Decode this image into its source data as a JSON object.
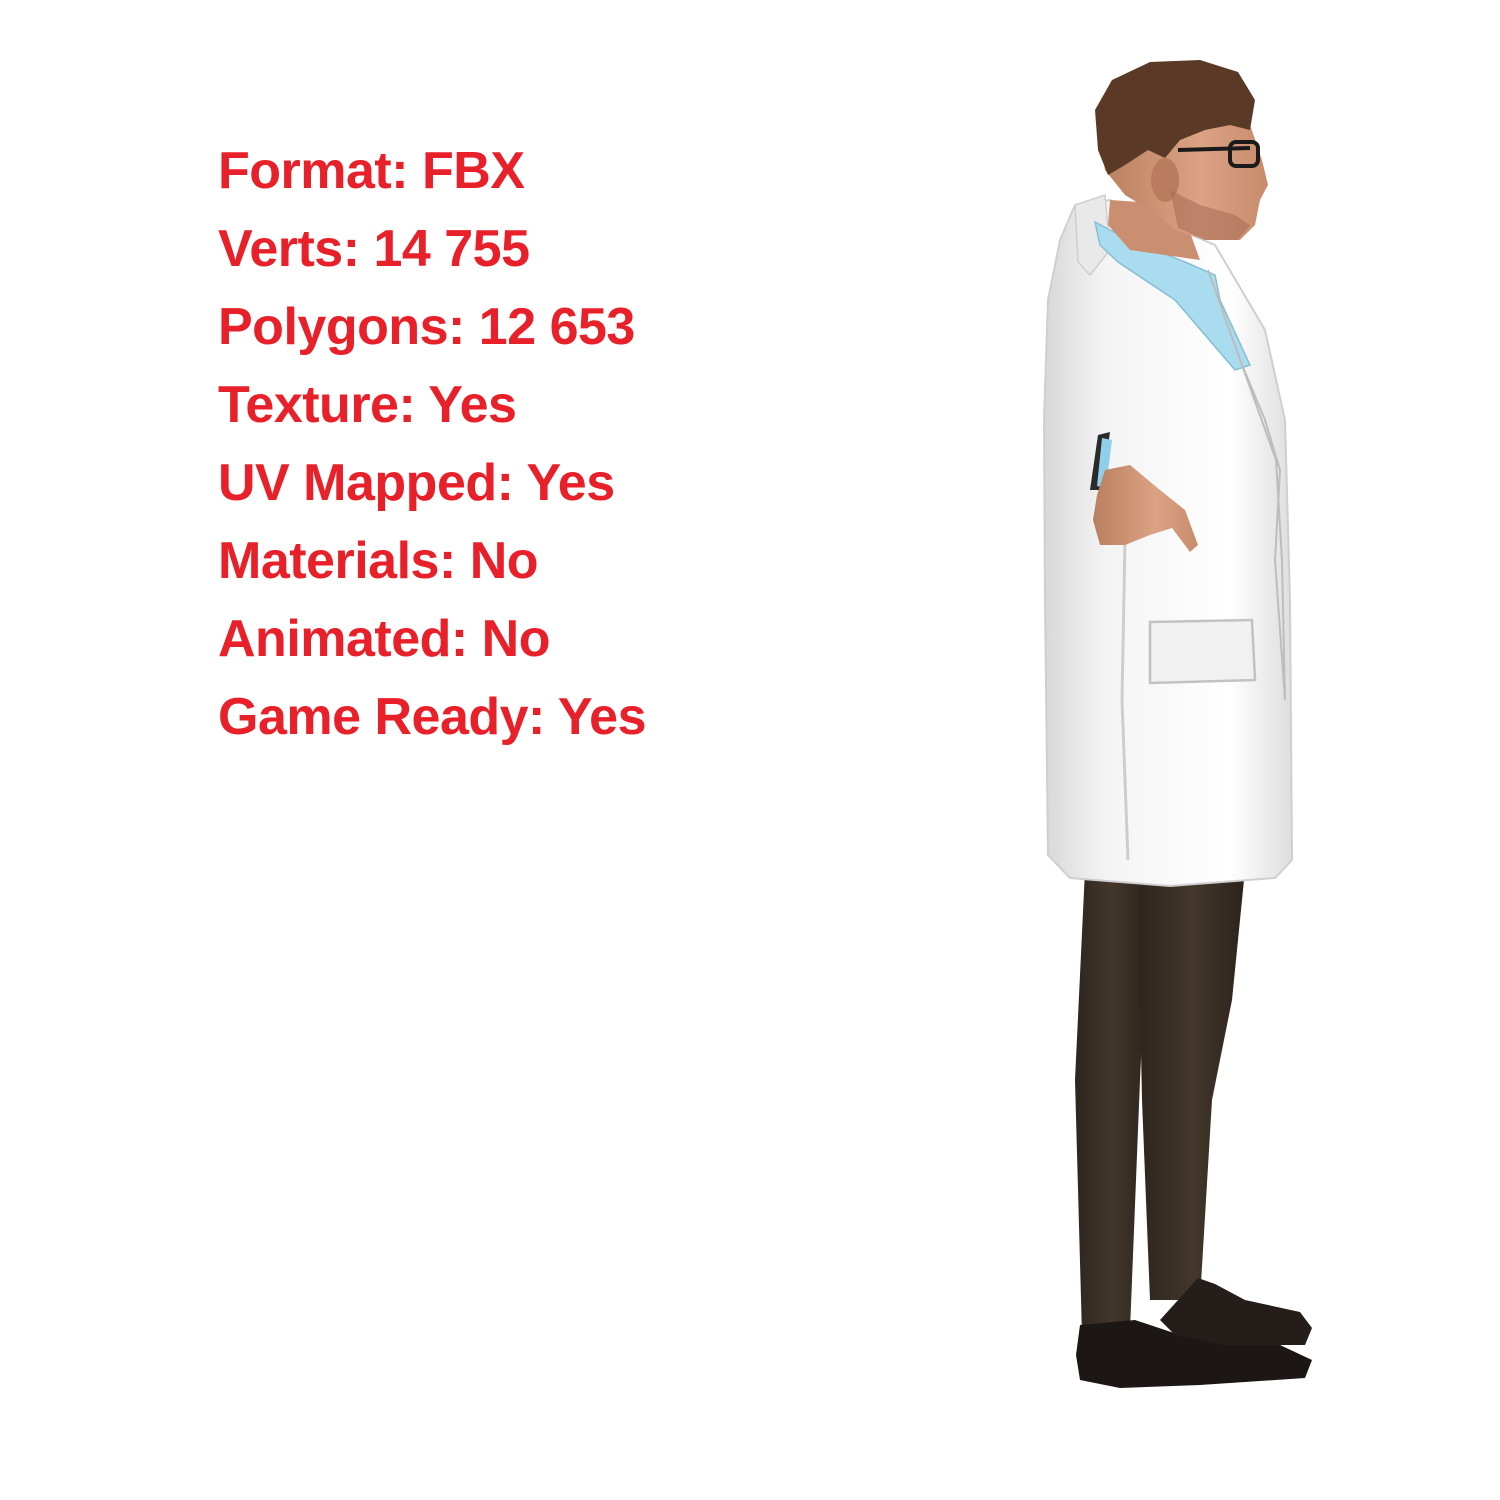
{
  "text_color": "#e8202a",
  "specs": [
    {
      "label": "Format: FBX"
    },
    {
      "label": "Verts: 14 755"
    },
    {
      "label": "Polygons: 12 653"
    },
    {
      "label": "Texture: Yes"
    },
    {
      "label": "UV Mapped: Yes"
    },
    {
      "label": "Materials: No"
    },
    {
      "label": "Animated: No"
    },
    {
      "label": "Game Ready: Yes"
    }
  ],
  "model": {
    "coat_color": "#f1f1f1",
    "shirt_color": "#a9dcef",
    "pants_color": "#3b3026",
    "shoe_color": "#1a1514",
    "skin_color": "#d59b7c",
    "hair_color": "#5a3a26"
  }
}
